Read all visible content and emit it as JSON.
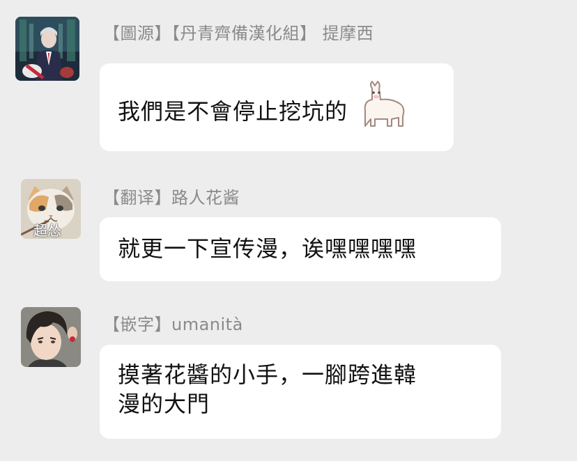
{
  "messages": [
    {
      "sender": "【圖源】【丹青齊備漢化組】 提摩西",
      "avatar_icon": "avatar-man-in-suit",
      "text": "我們是不會停止挖坑的",
      "sticker_icon": "alpaca-icon"
    },
    {
      "sender": "【翻译】路人花酱",
      "avatar_icon": "avatar-cat",
      "avatar_caption": "超怂",
      "text": "就更一下宣传漫，诶嘿嘿嘿嘿"
    },
    {
      "sender": "【嵌字】umanità",
      "avatar_icon": "avatar-anime-boy",
      "text_line1": "摸著花醬的小手，一腳跨進韓",
      "text_line2": "漫的大門"
    }
  ],
  "colors": {
    "background": "#ededed",
    "bubble": "#ffffff",
    "sender_text": "#8a8a8a",
    "message_text": "#111111"
  }
}
